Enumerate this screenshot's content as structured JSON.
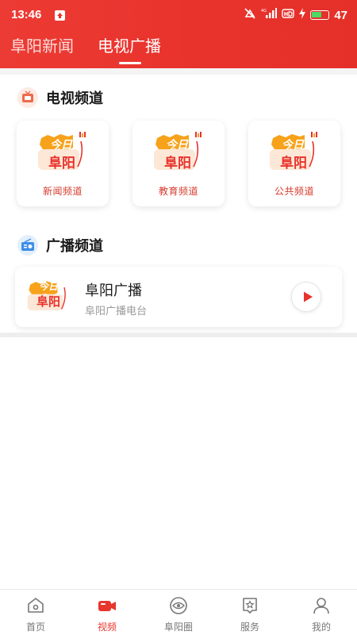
{
  "status_bar": {
    "time": "13:46",
    "battery_level": "47",
    "network": "4G"
  },
  "top_tabs": [
    {
      "label": "阜阳新闻",
      "active": false
    },
    {
      "label": "电视广播",
      "active": true
    }
  ],
  "tv_section": {
    "title": "电视频道",
    "channels": [
      {
        "label": "新闻频道",
        "logo_text_top": "今日",
        "logo_text_bottom": "阜阳"
      },
      {
        "label": "教育频道",
        "logo_text_top": "今日",
        "logo_text_bottom": "阜阳"
      },
      {
        "label": "公共频道",
        "logo_text_top": "今日",
        "logo_text_bottom": "阜阳"
      }
    ]
  },
  "radio_section": {
    "title": "广播频道",
    "items": [
      {
        "title": "阜阳广播",
        "subtitle": "阜阳广播电台",
        "logo_text_top": "今日",
        "logo_text_bottom": "阜阳"
      }
    ]
  },
  "bottom_nav": [
    {
      "label": "首页",
      "icon": "home-icon",
      "active": false
    },
    {
      "label": "视频",
      "icon": "video-camera-icon",
      "active": true
    },
    {
      "label": "阜阳圈",
      "icon": "eye-circle-icon",
      "active": false
    },
    {
      "label": "服务",
      "icon": "star-badge-icon",
      "active": false
    },
    {
      "label": "我的",
      "icon": "person-icon",
      "active": false
    }
  ],
  "colors": {
    "brand_red": "#e8322c",
    "accent_orange": "#f7a21b",
    "inactive_gray": "#777777"
  }
}
